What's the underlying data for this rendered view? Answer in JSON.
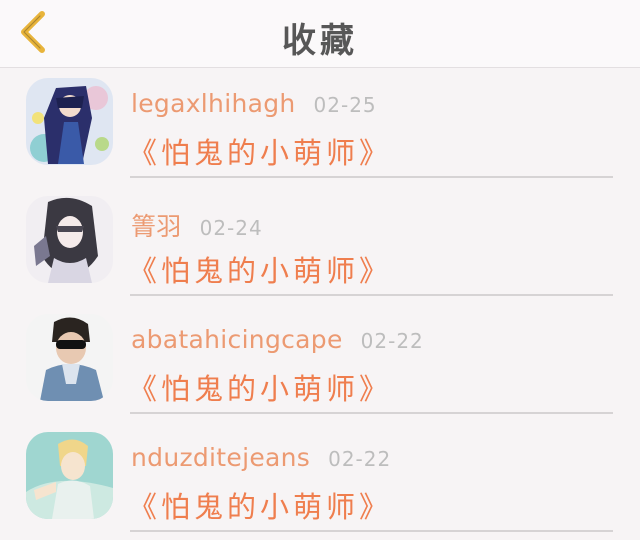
{
  "header": {
    "title": "收藏",
    "back_icon": "chevron-left-icon",
    "accent_color": "#e8b43a"
  },
  "colors": {
    "username": "#ec9a72",
    "book_title": "#ef7e4e",
    "date": "#bdbdbd"
  },
  "favorites": [
    {
      "username": "legaxlhihagh",
      "date": "02-25",
      "book_title": "《怕鬼的小萌师》"
    },
    {
      "username": "箐羽",
      "date": "02-24",
      "book_title": "《怕鬼的小萌师》"
    },
    {
      "username": "abatahicingcape",
      "date": "02-22",
      "book_title": "《怕鬼的小萌师》"
    },
    {
      "username": "nduzditejeans",
      "date": "02-22",
      "book_title": "《怕鬼的小萌师》"
    }
  ]
}
